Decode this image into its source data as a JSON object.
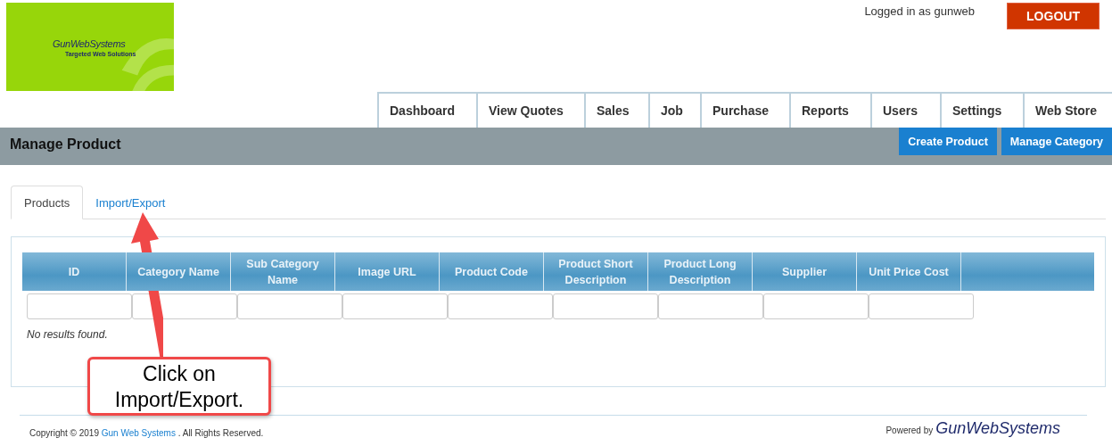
{
  "logo": {
    "name": "GunWebSystems",
    "tagline": "Targeted Web Solutions"
  },
  "user": {
    "status": "Logged in as gunweb",
    "logout": "LOGOUT"
  },
  "nav": [
    {
      "label": "Dashboard",
      "selected": false
    },
    {
      "label": "View Quotes",
      "selected": false
    },
    {
      "label": "Sales",
      "selected": false
    },
    {
      "label": "Job",
      "selected": false
    },
    {
      "label": "Purchase",
      "selected": false
    },
    {
      "label": "Reports",
      "selected": false
    },
    {
      "label": "Users",
      "selected": false
    },
    {
      "label": "Settings",
      "selected": false
    },
    {
      "label": "Web Store",
      "selected": false
    }
  ],
  "page": {
    "title": "Manage Product",
    "actions": [
      "Create Product",
      "Manage Category"
    ]
  },
  "tabs": [
    {
      "label": "Products",
      "selected": true
    },
    {
      "label": "Import/Export",
      "selected": false
    }
  ],
  "table": {
    "columns": [
      "ID",
      "Category Name",
      "Sub Category Name",
      "Image URL",
      "Product Code",
      "Product Short Description",
      "Product Long Description",
      "Supplier",
      "Unit Price Cost"
    ],
    "empty_message": "No results found."
  },
  "callout": {
    "text": "Click on Import/Export."
  },
  "footer": {
    "prefix": "Copyright © 2019",
    "link": "Gun Web Systems",
    "suffix": ". All Rights Reserved.",
    "powered_by": "Powered by",
    "powered_logo": "GunWebSystems"
  }
}
